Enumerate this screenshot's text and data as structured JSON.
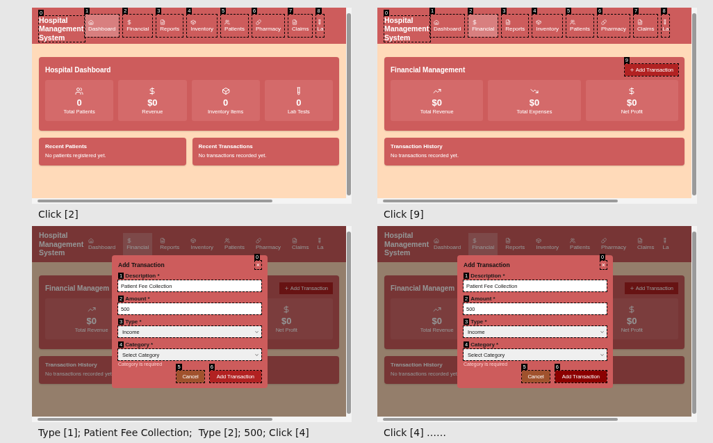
{
  "panels": [
    {
      "header": {
        "title": "Hospital Management System",
        "mark": "0",
        "nav": [
          {
            "label": "Dashboard",
            "selected": true,
            "mark": "1"
          },
          {
            "label": "Financial",
            "selected": false,
            "mark": "2"
          },
          {
            "label": "Reports",
            "selected": false,
            "mark": "3"
          },
          {
            "label": "Inventory",
            "selected": false,
            "mark": "4"
          },
          {
            "label": "Patients",
            "selected": false,
            "mark": "5"
          },
          {
            "label": "Pharmacy",
            "selected": false,
            "mark": "6"
          },
          {
            "label": "Claims",
            "selected": false,
            "mark": "7"
          },
          {
            "label": "La",
            "selected": false,
            "mark": "8"
          }
        ]
      },
      "content": {
        "kind": "dashboard",
        "title": "Hospital Dashboard",
        "stats": [
          {
            "value": "0",
            "label": "Total Patients"
          },
          {
            "value": "$0",
            "label": "Revenue"
          },
          {
            "value": "0",
            "label": "Inventory Items"
          },
          {
            "value": "0",
            "label": "Lab Tests"
          }
        ],
        "lists": [
          {
            "title": "Recent Patients",
            "empty_text": "No patients registered yet."
          },
          {
            "title": "Recent Transactions",
            "empty_text": "No transactions recorded yet."
          }
        ]
      },
      "caption": "Click [2]"
    },
    {
      "header": {
        "title": "Hospital Management System",
        "mark": "0",
        "nav": [
          {
            "label": "Dashboard",
            "selected": false,
            "mark": "1"
          },
          {
            "label": "Financial",
            "selected": true,
            "mark": "2"
          },
          {
            "label": "Reports",
            "selected": false,
            "mark": "3"
          },
          {
            "label": "Inventory",
            "selected": false,
            "mark": "4"
          },
          {
            "label": "Patients",
            "selected": false,
            "mark": "5"
          },
          {
            "label": "Pharmacy",
            "selected": false,
            "mark": "6"
          },
          {
            "label": "Claims",
            "selected": false,
            "mark": "7"
          },
          {
            "label": "La",
            "selected": false,
            "mark": "8"
          }
        ]
      },
      "content": {
        "kind": "financial",
        "title": "Financial Management",
        "add_button": {
          "label": "Add Transaction",
          "mark": "9"
        },
        "stats": [
          {
            "value": "$0",
            "label": "Total Revenue"
          },
          {
            "value": "$0",
            "label": "Total Expenses"
          },
          {
            "value": "$0",
            "label": "Net Profit"
          }
        ],
        "history": {
          "title": "Transaction History",
          "empty_text": "No transactions recorded yet."
        }
      },
      "caption": "Click [9]"
    },
    {
      "header": {
        "title": "Hospital Management System",
        "nav": [
          {
            "label": "Dashboard",
            "selected": false
          },
          {
            "label": "Financial",
            "selected": true
          },
          {
            "label": "Reports",
            "selected": false
          },
          {
            "label": "Inventory",
            "selected": false
          },
          {
            "label": "Patients",
            "selected": false
          },
          {
            "label": "Pharmacy",
            "selected": false
          },
          {
            "label": "Claims",
            "selected": false
          },
          {
            "label": "La",
            "selected": false
          }
        ]
      },
      "content": {
        "kind": "financial",
        "title": "Financial Managem",
        "add_button": {
          "label": "Add Transaction"
        },
        "stats": [
          {
            "value": "$0",
            "label": "Total Revenue"
          },
          {
            "value": "$0",
            "label": "Net Profit"
          }
        ],
        "history": {
          "title": "Transaction History",
          "empty_text": "No transactions recorded yet."
        }
      },
      "modal": {
        "title": "Add Transaction",
        "close": {
          "label": "×",
          "mark": "0"
        },
        "fields": [
          {
            "kind": "text",
            "label": "Description *",
            "value": "Patient Fee Collection",
            "mark": "1"
          },
          {
            "kind": "text",
            "label": "Amount *",
            "value": "500",
            "mark": "2"
          },
          {
            "kind": "select",
            "label": "Type *",
            "value": "Income",
            "mark": "3"
          },
          {
            "kind": "select",
            "label": "Category *",
            "value": "Select Category",
            "mark": "4",
            "error": "Category is required"
          }
        ],
        "buttons": [
          {
            "kind": "cancel",
            "label": "Cancel",
            "mark": "5",
            "hovered": false
          },
          {
            "kind": "submit",
            "label": "Add Transaction",
            "mark": "6",
            "hovered": false
          }
        ]
      },
      "caption": "Type [1]; Patient Fee Collection;  Type [2]; 500; Click [4]"
    },
    {
      "header": {
        "title": "Hospital Management System",
        "nav": [
          {
            "label": "Dashboard",
            "selected": false
          },
          {
            "label": "Financial",
            "selected": true
          },
          {
            "label": "Reports",
            "selected": false
          },
          {
            "label": "Inventory",
            "selected": false
          },
          {
            "label": "Patients",
            "selected": false
          },
          {
            "label": "Pharmacy",
            "selected": false
          },
          {
            "label": "Claims",
            "selected": false
          },
          {
            "label": "La",
            "selected": false
          }
        ]
      },
      "content": {
        "kind": "financial",
        "title": "Financial Managem",
        "add_button": {
          "label": "Add Transaction"
        },
        "stats": [
          {
            "value": "$0",
            "label": "Total Revenue"
          },
          {
            "value": "$0",
            "label": "Net Profit"
          }
        ],
        "history": {
          "title": "Transaction History",
          "empty_text": "No transactions recorded yet."
        }
      },
      "modal": {
        "title": "Add Transaction",
        "close": {
          "label": "×",
          "mark": "0"
        },
        "fields": [
          {
            "kind": "text",
            "label": "Description *",
            "value": "Patient Fee Collection",
            "mark": "1"
          },
          {
            "kind": "text",
            "label": "Amount *",
            "value": "500",
            "mark": "2"
          },
          {
            "kind": "select",
            "label": "Type *",
            "value": "Income",
            "mark": "3"
          },
          {
            "kind": "select",
            "label": "Category *",
            "value": "Select Category",
            "mark": "4",
            "error": "Category is required"
          }
        ],
        "buttons": [
          {
            "kind": "cancel",
            "label": "Cancel",
            "mark": "5",
            "hovered": false
          },
          {
            "kind": "submit",
            "label": "Add Transaction",
            "mark": "6",
            "hovered": true
          }
        ]
      },
      "caption": "Click [4] ……"
    }
  ]
}
